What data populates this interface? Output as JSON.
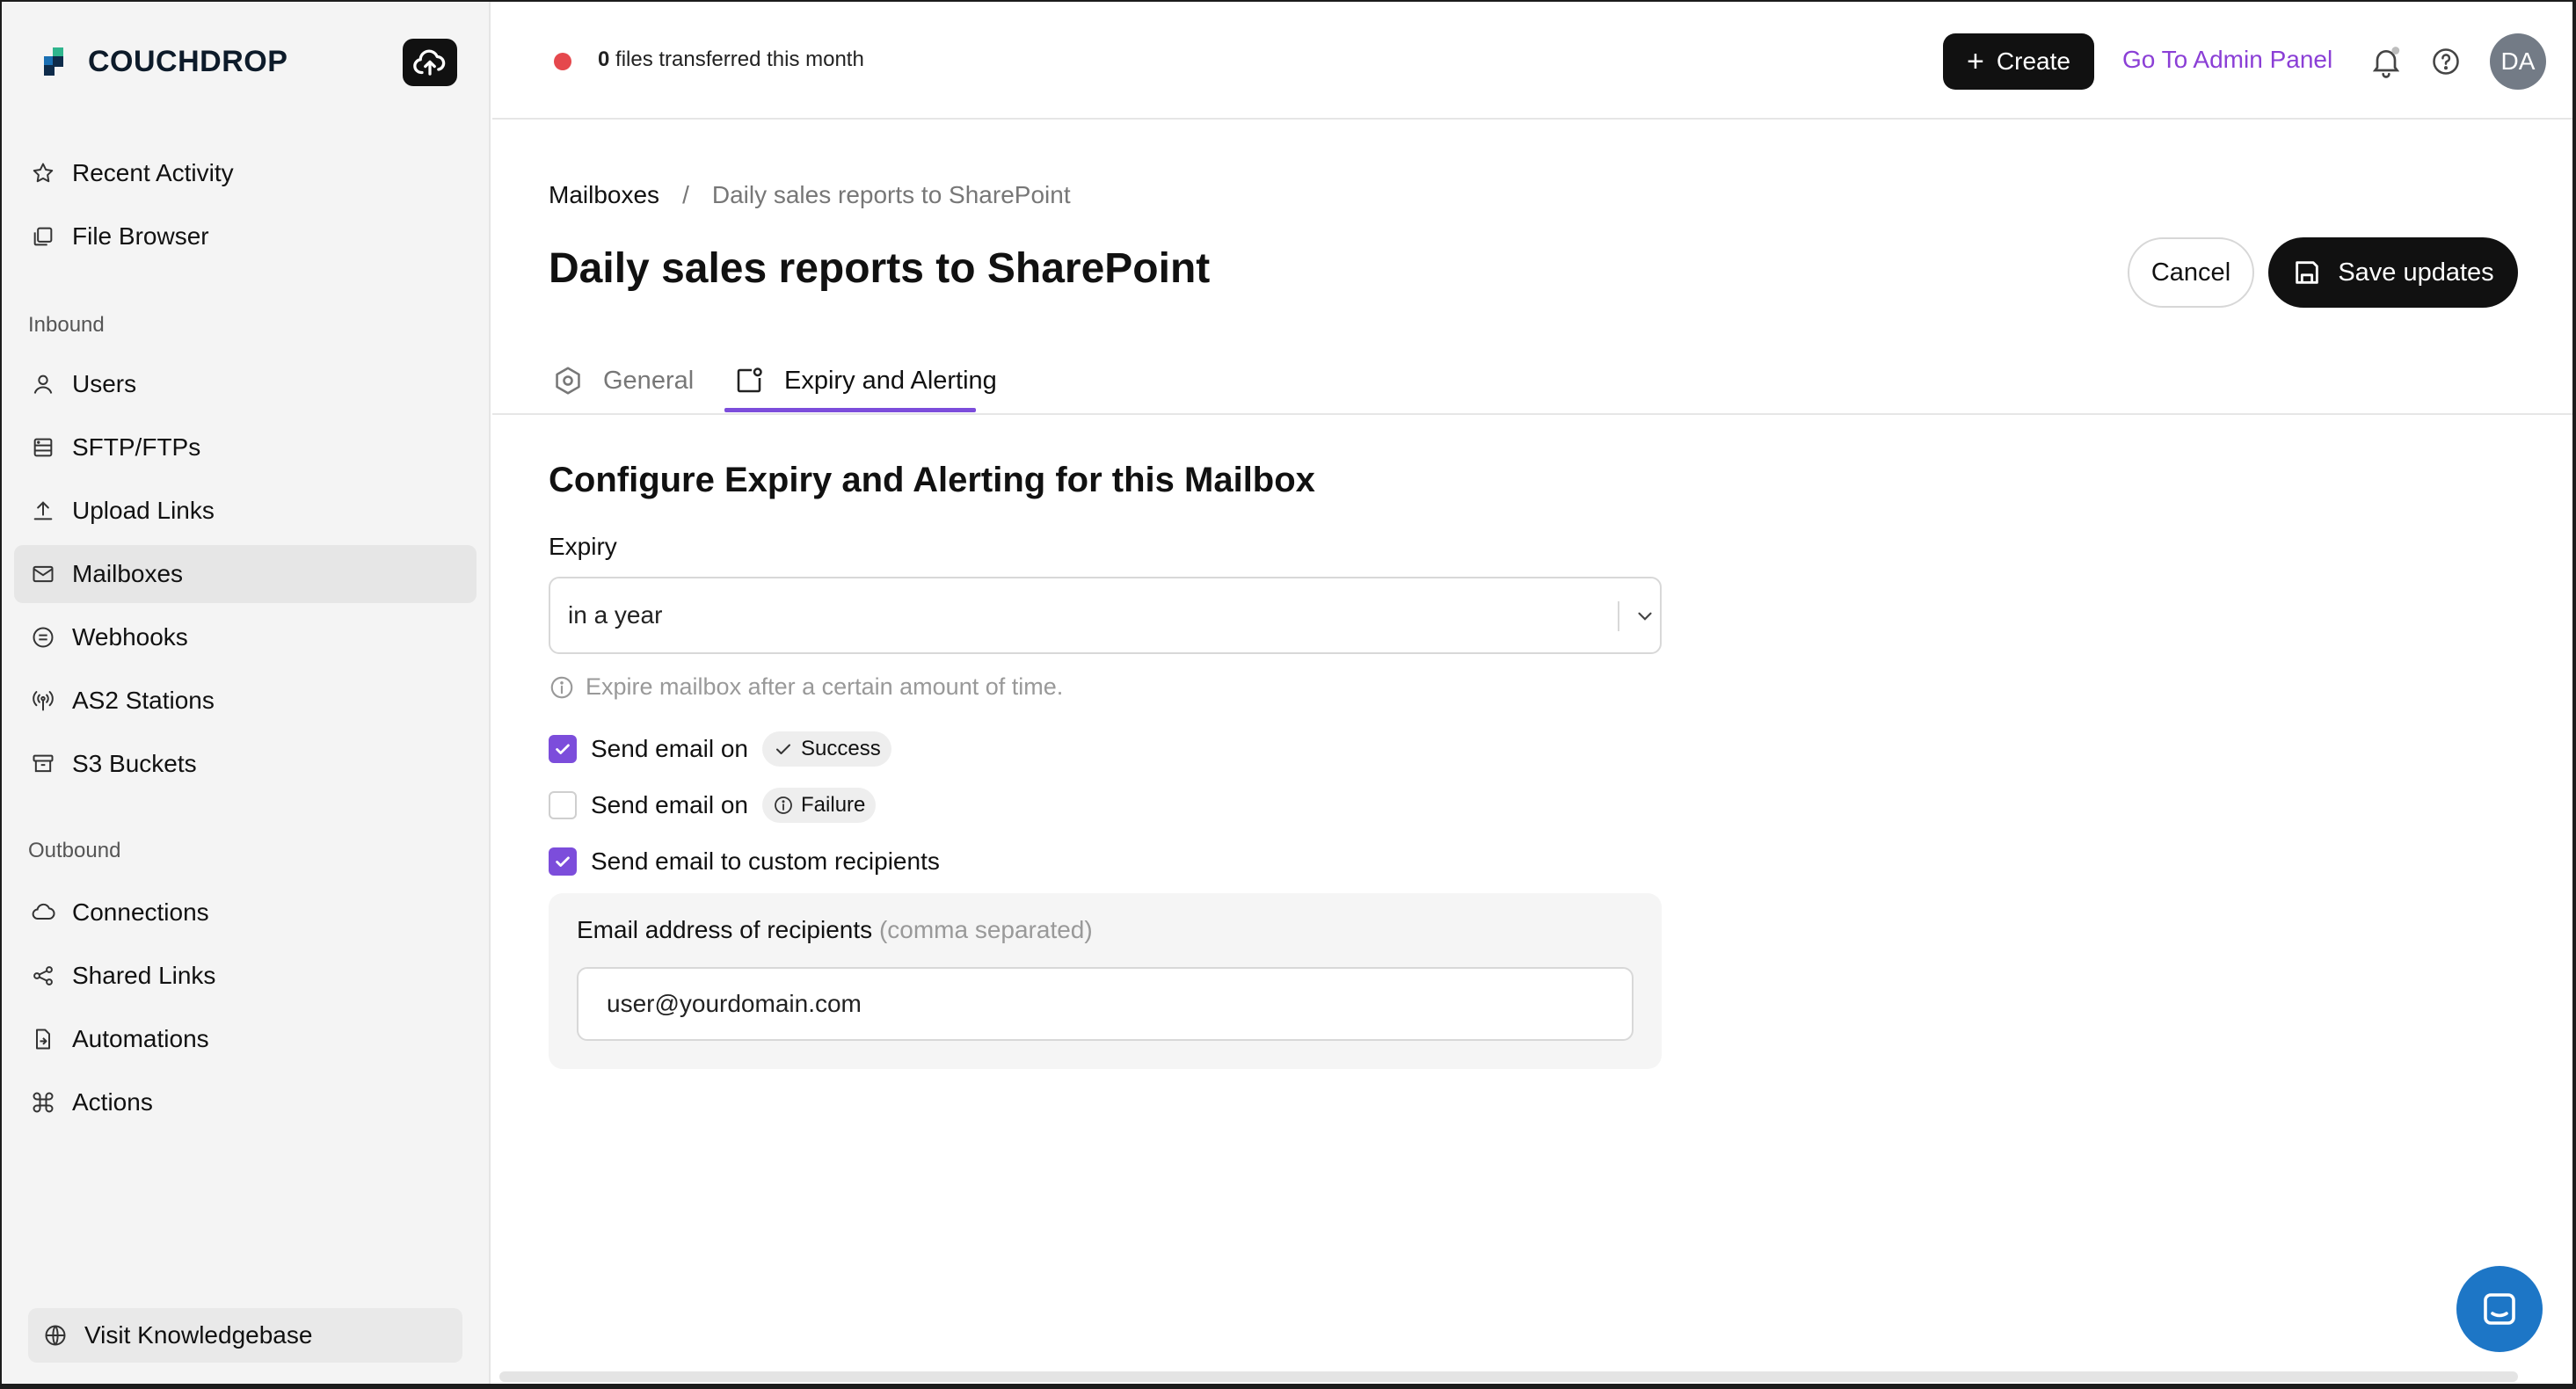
{
  "brand": {
    "name": "COUCHDROP"
  },
  "sidebar": {
    "top_items": [
      {
        "label": "Recent Activity",
        "icon": "star-icon"
      },
      {
        "label": "File Browser",
        "icon": "files-icon"
      }
    ],
    "inbound_title": "Inbound",
    "inbound_items": [
      {
        "label": "Users",
        "icon": "user-icon"
      },
      {
        "label": "SFTP/FTPs",
        "icon": "server-icon"
      },
      {
        "label": "Upload Links",
        "icon": "upload-icon"
      },
      {
        "label": "Mailboxes",
        "icon": "mail-icon",
        "active": true
      },
      {
        "label": "Webhooks",
        "icon": "webhook-icon"
      },
      {
        "label": "AS2 Stations",
        "icon": "antenna-icon"
      },
      {
        "label": "S3 Buckets",
        "icon": "archive-icon"
      }
    ],
    "outbound_title": "Outbound",
    "outbound_items": [
      {
        "label": "Connections",
        "icon": "cloud-icon"
      },
      {
        "label": "Shared Links",
        "icon": "share-icon"
      },
      {
        "label": "Automations",
        "icon": "automation-icon"
      },
      {
        "label": "Actions",
        "icon": "command-icon"
      }
    ],
    "knowledgebase_label": "Visit Knowledgebase"
  },
  "topbar": {
    "files_count": "0",
    "files_text": " files transferred this month",
    "create_label": "Create",
    "admin_label": "Go To Admin Panel",
    "avatar_initials": "DA"
  },
  "breadcrumb": {
    "root": "Mailboxes",
    "separator": "/",
    "current": "Daily sales reports to SharePoint"
  },
  "page": {
    "title": "Daily sales reports to SharePoint",
    "cancel_label": "Cancel",
    "save_label": "Save updates"
  },
  "tabs": [
    {
      "label": "General",
      "active": false
    },
    {
      "label": "Expiry and Alerting",
      "active": true
    }
  ],
  "form": {
    "section_title": "Configure Expiry and Alerting for this Mailbox",
    "expiry_label": "Expiry",
    "expiry_value": "in a year",
    "expiry_hint": "Expire mailbox after a certain amount of time.",
    "checks": [
      {
        "label": "Send email on",
        "pill": "Success",
        "checked": true
      },
      {
        "label": "Send email on",
        "pill": "Failure",
        "checked": false
      },
      {
        "label": "Send email to custom recipients",
        "checked": true
      }
    ],
    "recipients_label": "Email address of recipients",
    "recipients_hint": "(comma separated)",
    "recipients_value": "user@yourdomain.com"
  },
  "colors": {
    "accent": "#7c4ddb",
    "admin_link": "#8b3fd6",
    "status_dot": "#e5484d",
    "chat": "#1d76c6"
  }
}
